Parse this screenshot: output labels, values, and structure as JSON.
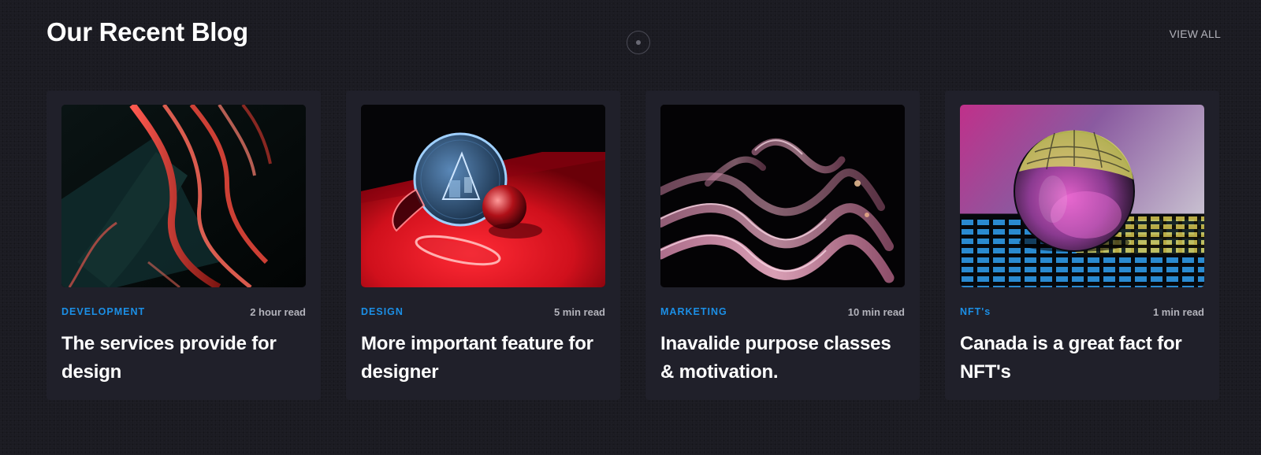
{
  "section": {
    "title": "Our Recent Blog",
    "view_all_label": "VIEW ALL"
  },
  "posts": [
    {
      "category": "DEVELOPMENT",
      "read_time": "2 hour read",
      "title": "The services provide for design",
      "image_icon": "abstract-red-glass-image"
    },
    {
      "category": "DESIGN",
      "read_time": "5 min read",
      "title": "More important feature for designer",
      "image_icon": "glass-shapes-on-red-image"
    },
    {
      "category": "MARKETING",
      "read_time": "10 min read",
      "title": "Inavalide purpose classes & motivation.",
      "image_icon": "pink-glass-waves-image"
    },
    {
      "category": "NFT's",
      "read_time": "1 min read",
      "title": "Canada is a great fact for NFT's",
      "image_icon": "crystal-sphere-grid-image"
    }
  ],
  "colors": {
    "background": "#1b1b22",
    "card": "#20202a",
    "accent": "#1b8fe6",
    "muted": "#b3b3bb"
  }
}
